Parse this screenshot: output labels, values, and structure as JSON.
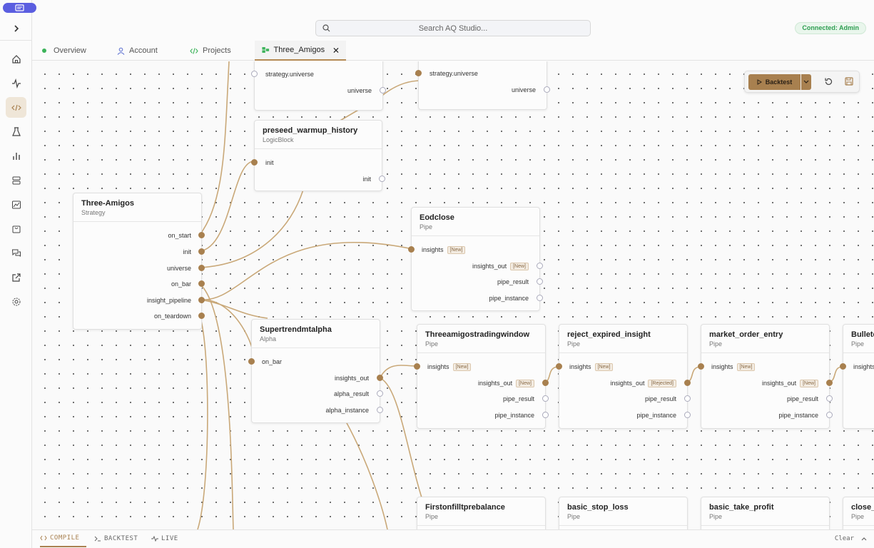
{
  "header": {
    "search_placeholder": "Search AQ Studio...",
    "connection_status": "Connected: Admin"
  },
  "tabs": [
    {
      "label": "Overview"
    },
    {
      "label": "Account"
    },
    {
      "label": "Projects"
    },
    {
      "label": "Three_Amigos"
    }
  ],
  "toolbar": {
    "backtest_label": "Backtest"
  },
  "nodes": {
    "topA": {
      "p1": "strategy.universe",
      "p2": "universe"
    },
    "topB": {
      "p1": "strategy.universe",
      "p2": "universe"
    },
    "preseed": {
      "name": "preseed_warmup_history",
      "type": "LogicBlock",
      "p1": "init",
      "p2": "init"
    },
    "strategy": {
      "name": "Three-Amigos",
      "type": "Strategy",
      "ports": [
        "on_start",
        "init",
        "universe",
        "on_bar",
        "insight_pipeline",
        "on_teardown"
      ]
    },
    "eod": {
      "name": "Eodclose",
      "type": "Pipe",
      "in": "insights",
      "out": "insights_out",
      "r": "pipe_result",
      "i": "pipe_instance",
      "badge_in": "[New]",
      "badge_out": "[New]"
    },
    "super": {
      "name": "Supertrendmtalpha",
      "type": "Alpha",
      "in": "on_bar",
      "o1": "insights_out",
      "o2": "alpha_result",
      "o3": "alpha_instance"
    },
    "window": {
      "name": "Threeamigostradingwindow",
      "type": "Pipe",
      "in": "insights",
      "out": "insights_out",
      "r": "pipe_result",
      "i": "pipe_instance",
      "badge_in": "[New]",
      "badge_out": "[New]"
    },
    "reject": {
      "name": "reject_expired_insight",
      "type": "Pipe",
      "in": "insights",
      "out": "insights_out",
      "r": "pipe_result",
      "i": "pipe_instance",
      "badge_in": "[New]",
      "badge_out": "[Rejected]"
    },
    "market": {
      "name": "market_order_entry",
      "type": "Pipe",
      "in": "insights",
      "out": "insights_out",
      "r": "pipe_result",
      "i": "pipe_instance",
      "badge_in": "[New]",
      "badge_out": "[New]"
    },
    "bullet": {
      "name": "Bulletc",
      "type": "Pipe",
      "in": "insights"
    },
    "first": {
      "name": "Firstonfilltprebalance",
      "type": "Pipe"
    },
    "stop": {
      "name": "basic_stop_loss",
      "type": "Pipe"
    },
    "take": {
      "name": "basic_take_profit",
      "type": "Pipe"
    },
    "close": {
      "name": "close_",
      "type": "Pipe"
    }
  },
  "bottom": {
    "tabs": [
      {
        "label": "COMPILE"
      },
      {
        "label": "BACKTEST"
      },
      {
        "label": "LIVE"
      }
    ],
    "clear_label": "Clear"
  },
  "colors": {
    "accent": "#a8804f",
    "connected": "#2e9e51",
    "pill": "#5b5ee0"
  }
}
